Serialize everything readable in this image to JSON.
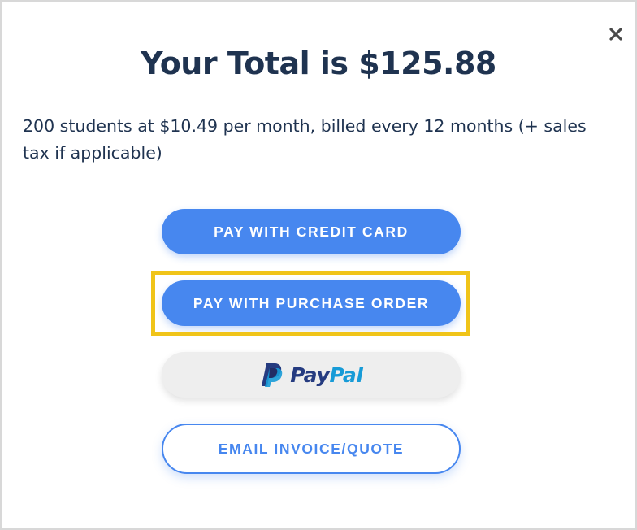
{
  "modal": {
    "close_icon": "close-icon",
    "title": "Your Total is $125.88",
    "description": "200 students at $10.49 per month, billed every 12 months (+ sales tax if applicable)"
  },
  "buttons": {
    "credit_card": "PAY WITH CREDIT CARD",
    "purchase_order": "PAY WITH PURCHASE ORDER",
    "paypal": {
      "icon": "paypal-logo-icon",
      "word_pay": "Pay",
      "word_pal": "Pal"
    },
    "email": "EMAIL INVOICE/QUOTE"
  },
  "colors": {
    "primary": "#4787ef",
    "title_text": "#1f3350",
    "highlight": "#f0c419",
    "paypal_dark": "#253b80",
    "paypal_light": "#179bd7"
  }
}
